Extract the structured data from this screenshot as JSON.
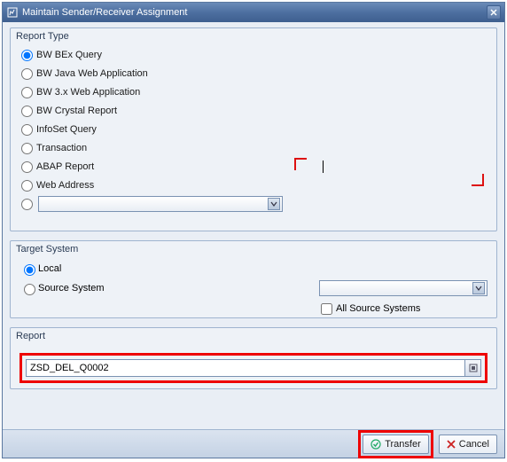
{
  "window": {
    "title": "Maintain Sender/Receiver Assignment"
  },
  "report_type": {
    "group_title": "Report Type",
    "options": {
      "bex": "BW BEx Query",
      "java": "BW Java Web Application",
      "bw3x": "BW 3.x Web Application",
      "crystal": "BW Crystal Report",
      "infoset": "InfoSet Query",
      "trans": "Transaction",
      "abap": "ABAP Report",
      "web": "Web Address"
    },
    "dropdown_value": ""
  },
  "target_system": {
    "group_title": "Target System",
    "options": {
      "local": "Local",
      "source": "Source System"
    },
    "dropdown_value": "",
    "all_label": "All Source Systems"
  },
  "report": {
    "group_title": "Report",
    "value": "ZSD_DEL_Q0002"
  },
  "footer": {
    "transfer": "Transfer",
    "cancel": "Cancel"
  }
}
